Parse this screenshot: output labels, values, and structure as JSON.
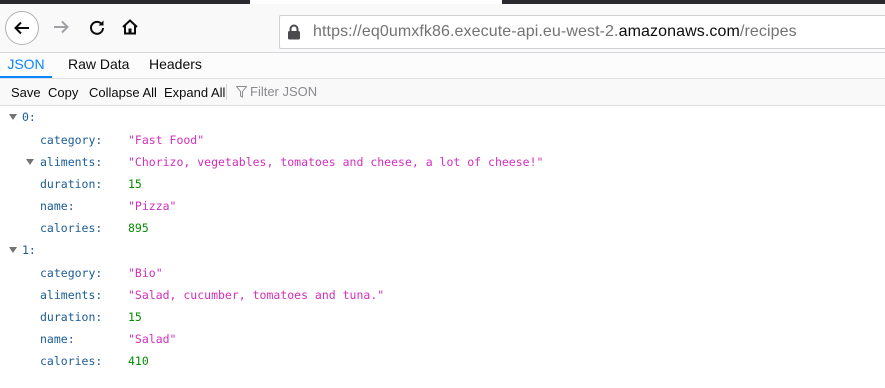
{
  "browser": {
    "url_prefix": "https://eq0umxfk86.execute-api.eu-west-2.",
    "url_domain": "amazonaws.com",
    "url_path": "/recipes"
  },
  "viewer_tabs": [
    {
      "label": "JSON",
      "active": true
    },
    {
      "label": "Raw Data",
      "active": false
    },
    {
      "label": "Headers",
      "active": false
    }
  ],
  "toolbar": {
    "save": "Save",
    "copy": "Copy",
    "collapse_all": "Collapse All",
    "expand_all": "Expand All",
    "filter_placeholder": "Filter JSON"
  },
  "records": [
    {
      "index": "0:",
      "fields": [
        {
          "key": "category:",
          "value": "\"Fast Food\"",
          "kind": "string"
        },
        {
          "key": "aliments:",
          "value": "\"Chorizo, vegetables, tomatoes and cheese, a lot of cheese!\"",
          "kind": "string"
        },
        {
          "key": "duration:",
          "value": "15",
          "kind": "number"
        },
        {
          "key": "name:",
          "value": "\"Pizza\"",
          "kind": "string"
        },
        {
          "key": "calories:",
          "value": "895",
          "kind": "number"
        }
      ]
    },
    {
      "index": "1:",
      "fields": [
        {
          "key": "category:",
          "value": "\"Bio\"",
          "kind": "string"
        },
        {
          "key": "aliments:",
          "value": "\"Salad, cucumber, tomatoes and tuna.\"",
          "kind": "string"
        },
        {
          "key": "duration:",
          "value": "15",
          "kind": "number"
        },
        {
          "key": "name:",
          "value": "\"Salad\"",
          "kind": "string"
        },
        {
          "key": "calories:",
          "value": "410",
          "kind": "number"
        }
      ]
    }
  ],
  "colors": {
    "accent": "#0a84ff",
    "key": "#1b5c97",
    "string": "#d12fbd",
    "number": "#058b00"
  }
}
